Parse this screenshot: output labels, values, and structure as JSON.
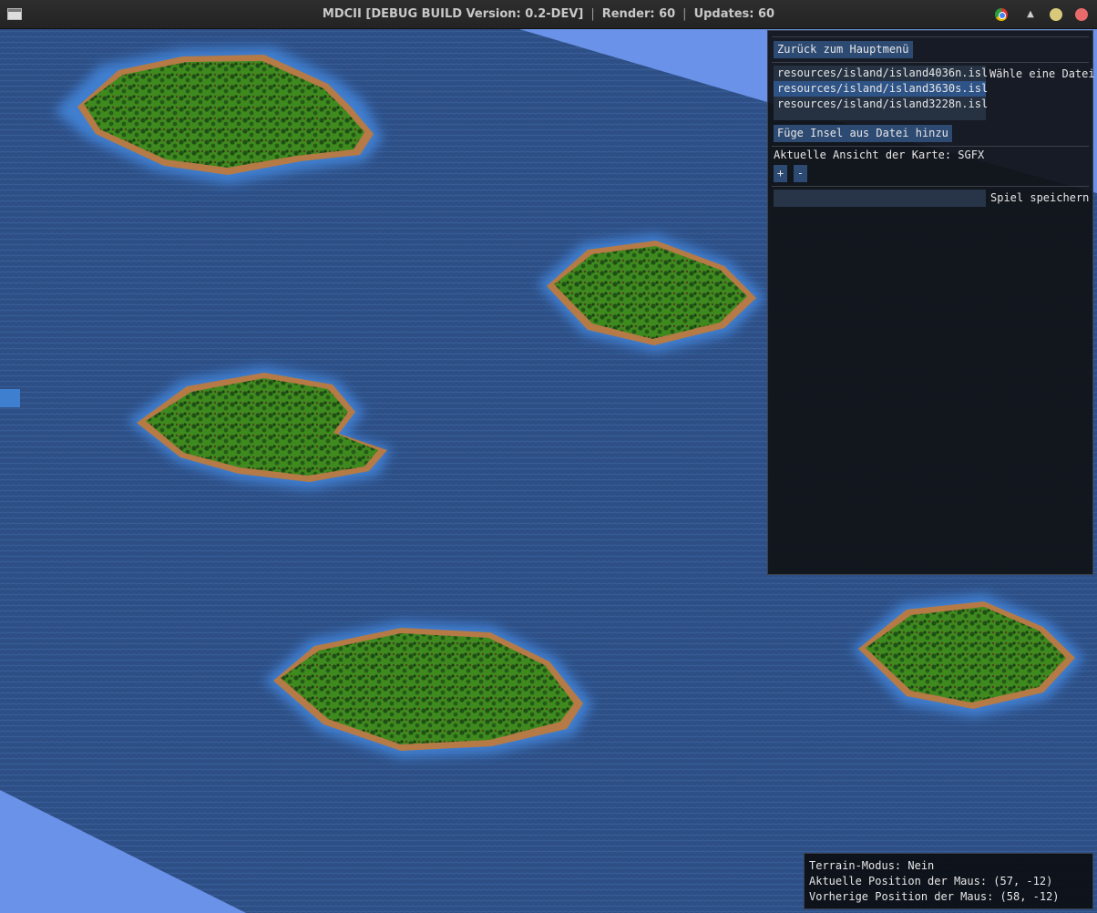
{
  "window": {
    "title": "MDCII [DEBUG BUILD Version: 0.2-DEV]",
    "render_label": "Render: 60",
    "updates_label": "Updates: 60"
  },
  "panel": {
    "back_button": "Zurück zum Hauptmenü",
    "files": [
      "resources/island/island4036n.isl",
      "resources/island/island3630s.isl",
      "resources/island/island3228n.isl"
    ],
    "selected_file_index": 1,
    "file_list_label": "Wähle eine Datei",
    "add_island_button": "Füge Insel aus Datei hinzu",
    "map_view_label": "Aktuelle Ansicht der Karte: SGFX",
    "zoom_in": "+",
    "zoom_out": "-",
    "save_input_value": "",
    "save_label": "Spiel speichern"
  },
  "status": {
    "terrain_mode": "Terrain-Modus: Nein",
    "current_mouse": "Aktuelle Position der Maus: (57, -12)",
    "previous_mouse": "Vorherige Position der Maus: (58, -12)"
  },
  "colors": {
    "ocean": "#2d4f86",
    "ocean_edge": "#6a92e8",
    "shallow_water": "#3f7fd0",
    "grass": "#3f8a1e",
    "beach": "#b57a45",
    "button": "#2d4a72",
    "selection": "#2e5386"
  },
  "icons": {
    "app": "window-icon",
    "browser": "chrome-icon",
    "up": "chevron-up-icon"
  }
}
